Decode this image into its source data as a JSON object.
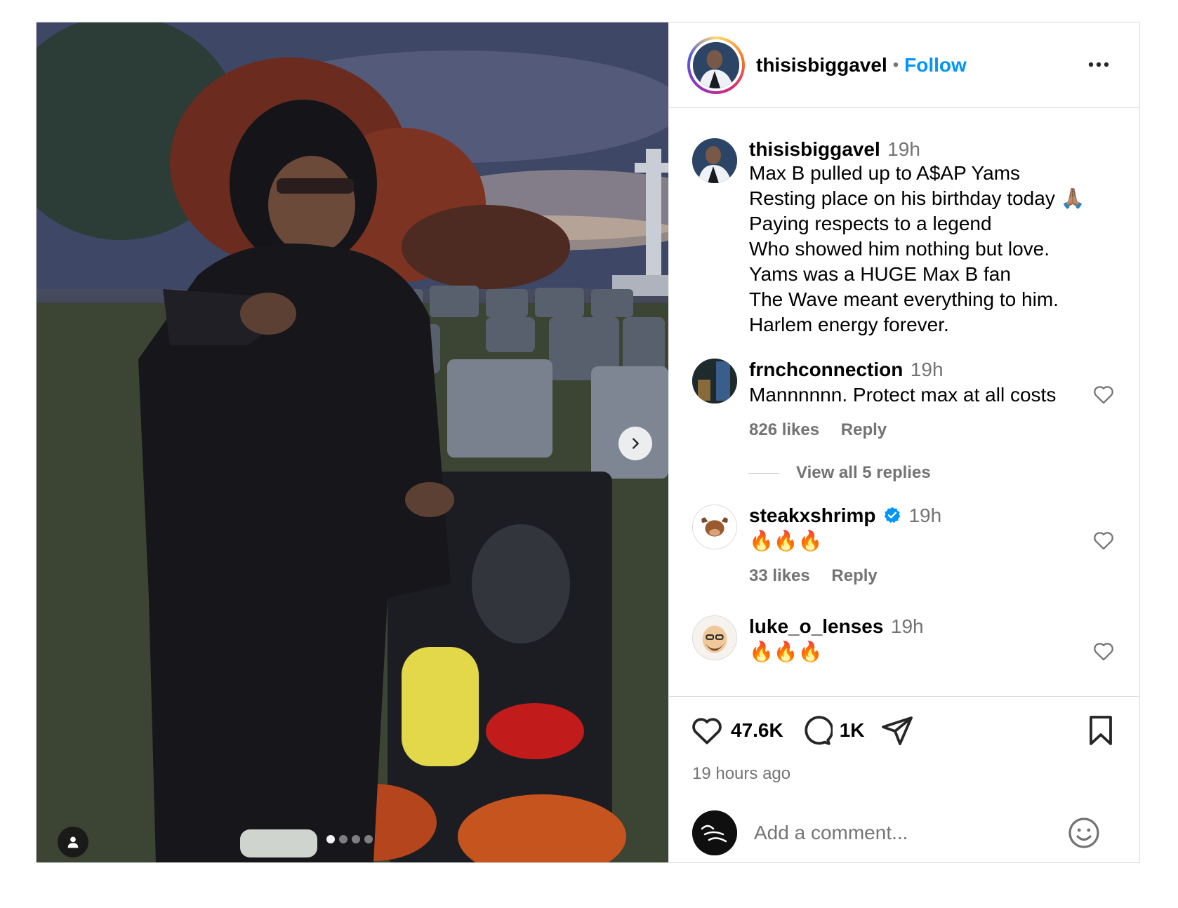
{
  "post": {
    "username": "thisisbiggavel",
    "separator": "•",
    "follow_label": "Follow",
    "more_icon": "more-horizontal-icon",
    "caption": {
      "username": "thisisbiggavel",
      "time": "19h",
      "text": "Max B pulled up to A$AP Yams\nResting place on his birthday today 🙏🏽\nPaying respects to a legend\nWho showed him nothing but love.\nYams was a HUGE Max B fan\nThe Wave meant everything to him.\nHarlem energy forever."
    },
    "comments": [
      {
        "username": "frnchconnection",
        "time": "19h",
        "text": "Mannnnnn. Protect max at all costs",
        "likes": "826 likes",
        "reply": "Reply",
        "verified": false
      },
      {
        "username": "steakxshrimp",
        "time": "19h",
        "text": "🔥🔥🔥",
        "likes": "33 likes",
        "reply": "Reply",
        "verified": true
      },
      {
        "username": "luke_o_lenses",
        "time": "19h",
        "text": "🔥🔥🔥",
        "verified": false
      }
    ],
    "view_replies_label": "View all 5 replies",
    "likes_count": "47.6K",
    "comments_count": "1K",
    "time_ago": "19 hours ago",
    "add_comment_placeholder": "Add a comment...",
    "carousel": {
      "slide_count": 4,
      "active_index": 0
    }
  },
  "colors": {
    "follow_blue": "#0095f6",
    "verified_blue": "#0095f6",
    "muted_text": "#737373",
    "border": "#dbdbdb"
  },
  "icons": [
    "heart-icon",
    "comment-icon",
    "share-icon",
    "bookmark-icon",
    "emoji-icon",
    "chevron-right-icon",
    "user-tag-icon",
    "verified-badge-icon"
  ]
}
